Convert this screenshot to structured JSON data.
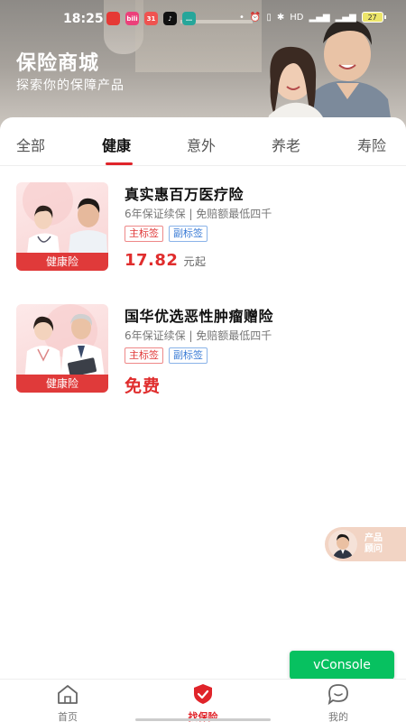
{
  "status_bar": {
    "time": "18:25",
    "battery": "27",
    "apps": [
      {
        "icon": "app-red-icon",
        "color": "#e53935",
        "text": ""
      },
      {
        "icon": "app-pink-icon",
        "color": "#ec407a",
        "text": "bili"
      },
      {
        "icon": "calendar-icon",
        "color": "#ef5350",
        "text": "31"
      },
      {
        "icon": "tiktok-icon",
        "color": "#111111",
        "text": "♪"
      },
      {
        "icon": "message-icon",
        "color": "#26a69a",
        "text": "…"
      }
    ]
  },
  "hero": {
    "title": "保险商城",
    "subtitle": "探索你的保障产品"
  },
  "tabs": {
    "items": [
      "全部",
      "健康",
      "意外",
      "养老",
      "寿险"
    ],
    "active": "健康"
  },
  "products": [
    {
      "thumb_tag": "健康险",
      "title": "真实惠百万医疗险",
      "desc": "6年保证续保 | 免赔额最低四千",
      "tag_main": "主标签",
      "tag_sub": "副标签",
      "price": "17.82",
      "price_unit": "元起"
    },
    {
      "thumb_tag": "健康险",
      "title": "国华优选恶性肿瘤赠险",
      "desc": "6年保证续保 | 免赔额最低四千",
      "tag_main": "主标签",
      "tag_sub": "副标签",
      "free_label": "免费"
    }
  ],
  "advisor": {
    "line1": "产品",
    "line2": "顾问"
  },
  "vconsole": "vConsole",
  "bottom_nav": {
    "items": [
      {
        "label": "首页",
        "icon": "home-icon"
      },
      {
        "label": "找保险",
        "icon": "shield-check-icon"
      },
      {
        "label": "我的",
        "icon": "chat-bubble-icon"
      }
    ],
    "active": "找保险"
  },
  "colors": {
    "accent": "#e0242a",
    "price": "#e02d2d",
    "vconsole": "#07c160"
  }
}
